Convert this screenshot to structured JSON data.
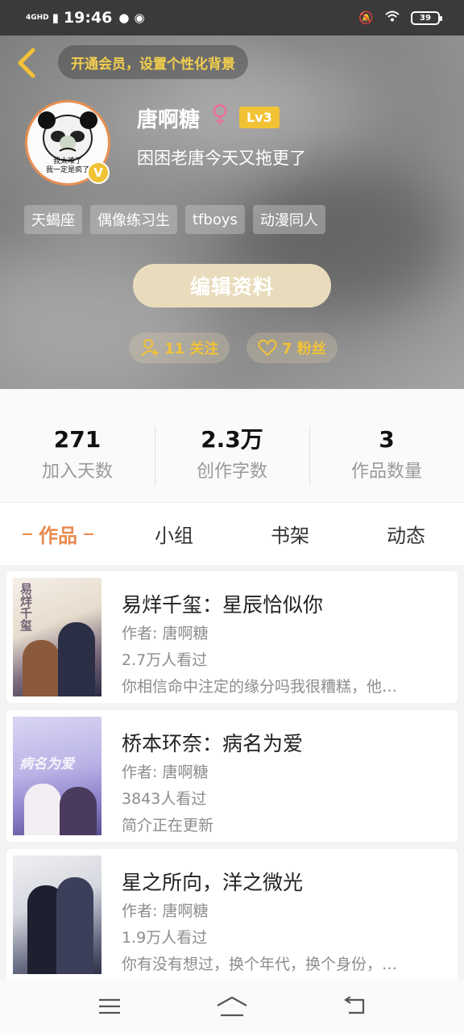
{
  "status_bar": {
    "network": "4GHD",
    "time": "19:46",
    "battery": "39"
  },
  "header": {
    "member_banner": "开通会员，设置个性化背景",
    "avatar_caption_line1": "我太难了",
    "avatar_caption_line2": "我一定是疯了",
    "username": "唐啊糖",
    "gender_symbol": "♀",
    "level": "Lv3",
    "signature": "困困老唐今天又拖更了",
    "tags": [
      "天蝎座",
      "偶像练习生",
      "tfboys",
      "动漫同人"
    ],
    "edit_button": "编辑资料",
    "following_label": "11 关注",
    "fans_label": "7 粉丝"
  },
  "stats": [
    {
      "value": "271",
      "label": "加入天数"
    },
    {
      "value": "2.3万",
      "label": "创作字数"
    },
    {
      "value": "3",
      "label": "作品数量"
    }
  ],
  "tabs": [
    "作品",
    "小组",
    "书架",
    "动态"
  ],
  "works": [
    {
      "title": "易烊千玺：星辰恰似你",
      "author": "作者: 唐啊糖",
      "views": "2.7万人看过",
      "desc": "你相信命中注定的缘分吗我很糟糕，他…",
      "cover_text": "易烊千玺"
    },
    {
      "title": "桥本环奈：病名为爱",
      "author": "作者: 唐啊糖",
      "views": "3843人看过",
      "desc": "简介正在更新",
      "cover_text": "病名为爱"
    },
    {
      "title": "星之所向，洋之微光",
      "author": "作者: 唐啊糖",
      "views": "1.9万人看过",
      "desc": "你有没有想过，换个年代，换个身份，…",
      "cover_text": ""
    }
  ],
  "colors": {
    "accent": "#e98a4e",
    "gold": "#f2c235",
    "edit_button_bg": "#e9dcbc"
  }
}
